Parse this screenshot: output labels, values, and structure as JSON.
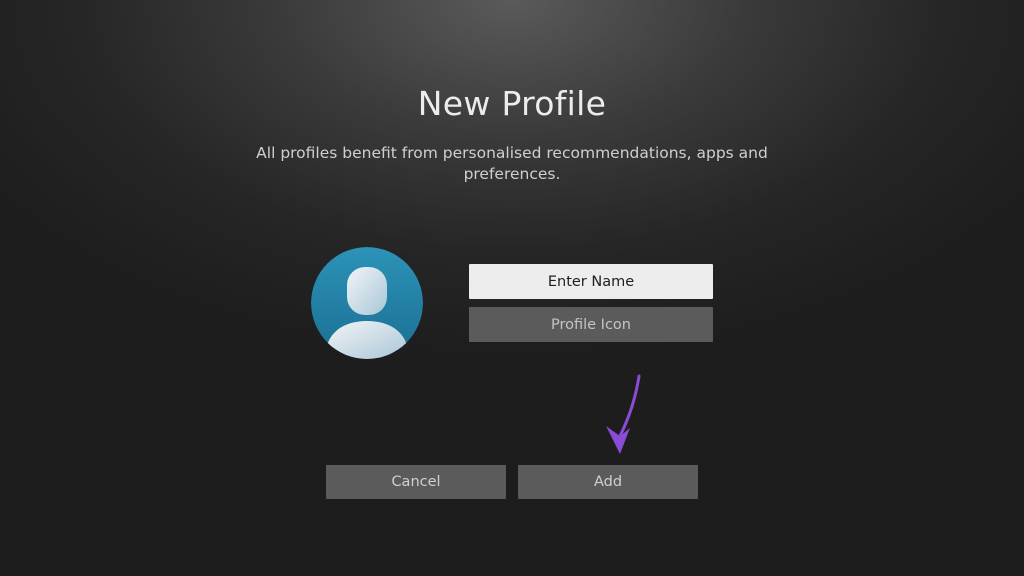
{
  "page": {
    "title": "New Profile",
    "subtitle": "All profiles benefit from personalised recommendations, apps and preferences."
  },
  "form": {
    "enter_name_label": "Enter Name",
    "profile_icon_label": "Profile Icon",
    "focused_field": "Enter Name"
  },
  "actions": {
    "cancel_label": "Cancel",
    "add_label": "Add"
  },
  "avatar": {
    "icon": "default-user-avatar-icon",
    "color": "#2f8fb3"
  },
  "annotation": {
    "icon": "arrow-pointer-icon",
    "color": "#8a4bd6"
  }
}
